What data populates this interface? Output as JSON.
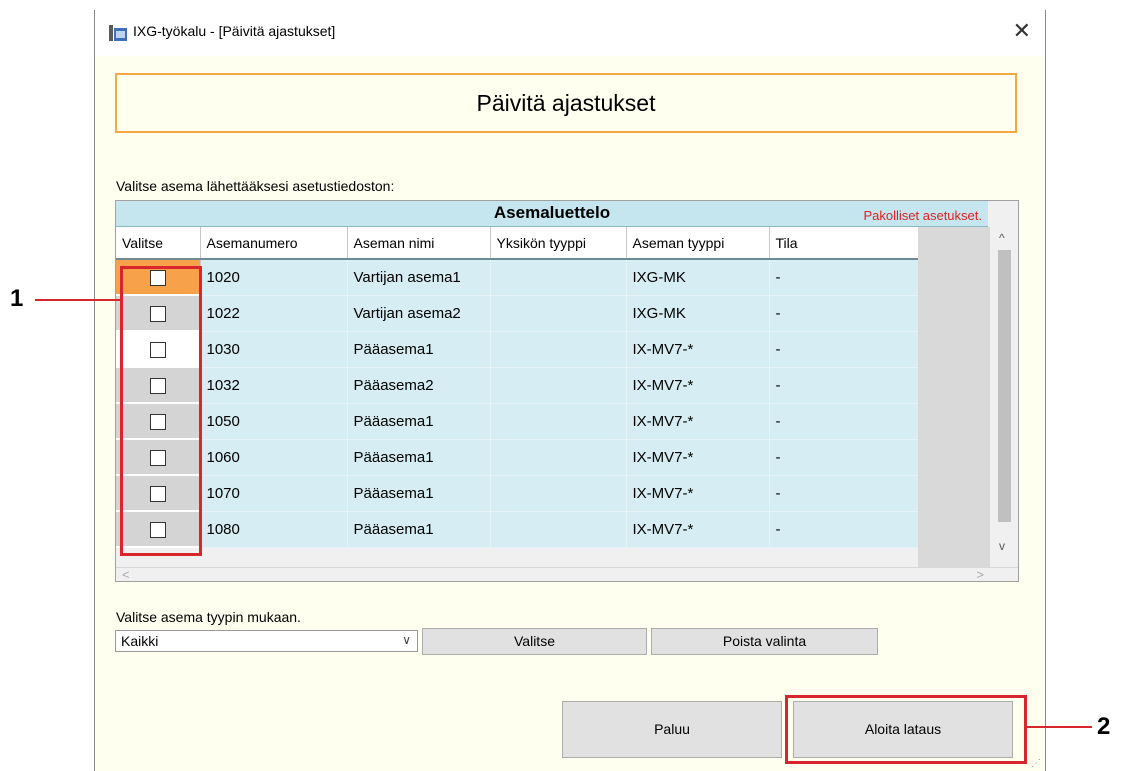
{
  "window": {
    "title": "IXG-työkalu - [Päivitä ajastukset]",
    "icon": "app-icon",
    "close_icon": "close-icon"
  },
  "banner": {
    "title": "Päivitä ajastukset"
  },
  "instruction": "Valitse asema lähettääksesi asetustiedoston:",
  "station_table": {
    "caption": "Asemaluettelo",
    "required_note": "Pakolliset asetukset.",
    "columns": [
      "Valitse",
      "Asemanumero",
      "Aseman nimi",
      "Yksikön tyyppi",
      "Aseman tyyppi",
      "Tila"
    ],
    "rows": [
      {
        "number": "1020",
        "name": "Vartijan asema1",
        "unit_type": "",
        "station_type": "IXG-MK",
        "status": "-",
        "checked": false
      },
      {
        "number": "1022",
        "name": "Vartijan asema2",
        "unit_type": "",
        "station_type": "IXG-MK",
        "status": "-",
        "checked": false
      },
      {
        "number": "1030",
        "name": "Pääasema1",
        "unit_type": "",
        "station_type": "IX-MV7-*",
        "status": "-",
        "checked": false
      },
      {
        "number": "1032",
        "name": "Pääasema2",
        "unit_type": "",
        "station_type": "IX-MV7-*",
        "status": "-",
        "checked": false
      },
      {
        "number": "1050",
        "name": "Pääasema1",
        "unit_type": "",
        "station_type": "IX-MV7-*",
        "status": "-",
        "checked": false
      },
      {
        "number": "1060",
        "name": "Pääasema1",
        "unit_type": "",
        "station_type": "IX-MV7-*",
        "status": "-",
        "checked": false
      },
      {
        "number": "1070",
        "name": "Pääasema1",
        "unit_type": "",
        "station_type": "IX-MV7-*",
        "status": "-",
        "checked": false
      },
      {
        "number": "1080",
        "name": "Pääasema1",
        "unit_type": "",
        "station_type": "IX-MV7-*",
        "status": "-",
        "checked": false
      }
    ]
  },
  "type_filter": {
    "label": "Valitse asema tyypin mukaan.",
    "selected": "Kaikki",
    "select_button": "Valitse",
    "deselect_button": "Poista valinta"
  },
  "footer": {
    "back_button": "Paluu",
    "start_button": "Aloita lataus"
  },
  "callouts": [
    "1",
    "2"
  ],
  "colors": {
    "highlight_orange": "#f7a24b",
    "banner_border": "#f4a742",
    "table_row": "#d6edf3",
    "callout_red": "#d9262c",
    "required_red": "#e02020"
  }
}
